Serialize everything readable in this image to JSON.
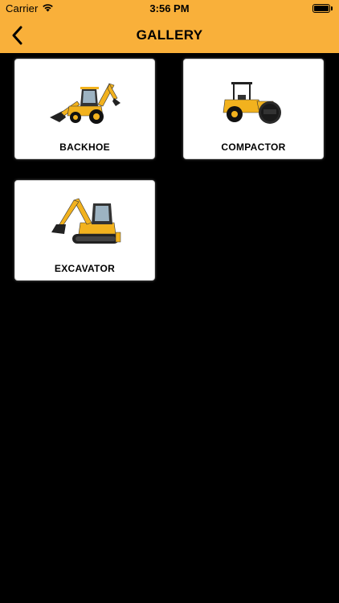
{
  "status_bar": {
    "carrier": "Carrier",
    "time": "3:56 PM",
    "wifi_icon": "wifi-icon",
    "battery_icon": "battery-icon"
  },
  "nav": {
    "title": "GALLERY",
    "back_icon": "chevron-left-icon"
  },
  "colors": {
    "header_bg": "#F9B03A",
    "page_bg": "#000000",
    "card_bg": "#FFFFFF",
    "machine_yellow": "#F2B21E"
  },
  "gallery": {
    "items": [
      {
        "label": "BACKHOE",
        "icon": "backhoe-image"
      },
      {
        "label": "COMPACTOR",
        "icon": "compactor-image"
      },
      {
        "label": "EXCAVATOR",
        "icon": "excavator-image"
      }
    ]
  }
}
